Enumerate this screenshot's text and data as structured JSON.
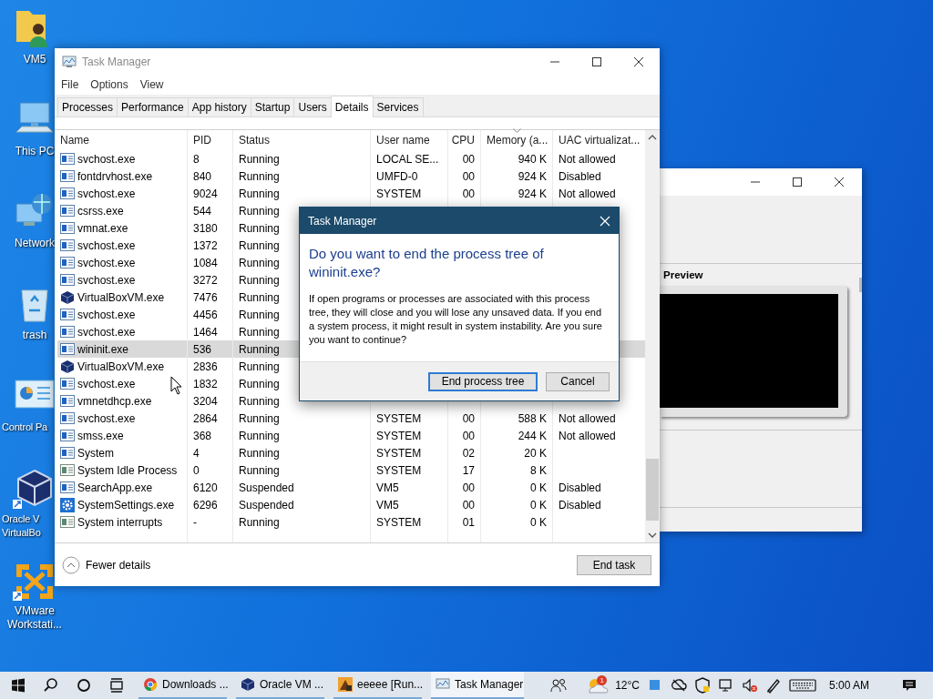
{
  "desktop_icons": [
    {
      "kind": "user-folder",
      "lines": [
        "VM5"
      ]
    },
    {
      "kind": "pc",
      "lines": [
        "This PC"
      ]
    },
    {
      "kind": "network",
      "lines": [
        "Network"
      ]
    },
    {
      "kind": "recycle-bin",
      "lines": [
        "trash"
      ]
    },
    {
      "kind": "control-panel",
      "lines": [
        "Control Pa"
      ]
    },
    {
      "kind": "virtualbox",
      "lines": [
        "Oracle V",
        "VirtualBo"
      ]
    },
    {
      "kind": "vmware",
      "lines": [
        "VMware",
        "Workstati..."
      ]
    }
  ],
  "task_manager": {
    "title": "Task Manager",
    "menu": [
      "File",
      "Options",
      "View"
    ],
    "tabs": [
      {
        "label": "Processes",
        "selected": false
      },
      {
        "label": "Performance",
        "selected": false
      },
      {
        "label": "App history",
        "selected": false
      },
      {
        "label": "Startup",
        "selected": false
      },
      {
        "label": "Users",
        "selected": false
      },
      {
        "label": "Details",
        "selected": true
      },
      {
        "label": "Services",
        "selected": false
      }
    ],
    "columns": [
      {
        "label": "Name",
        "sorted": false
      },
      {
        "label": "PID",
        "sorted": false
      },
      {
        "label": "Status",
        "sorted": false
      },
      {
        "label": "User name",
        "sorted": false
      },
      {
        "label": "CPU",
        "sorted": false
      },
      {
        "label": "Memory (a...",
        "sorted": true
      },
      {
        "label": "UAC virtualizat...",
        "sorted": false
      }
    ],
    "rows": [
      {
        "kind": "app",
        "name": "svchost.exe",
        "pid": "8",
        "status": "Running",
        "user_name": "LOCAL SE...",
        "cpu": "00",
        "memory": "940 K",
        "uac": "Not allowed",
        "selected": false
      },
      {
        "kind": "app",
        "name": "fontdrvhost.exe",
        "pid": "840",
        "status": "Running",
        "user_name": "UMFD-0",
        "cpu": "00",
        "memory": "924 K",
        "uac": "Disabled",
        "selected": false
      },
      {
        "kind": "app",
        "name": "svchost.exe",
        "pid": "9024",
        "status": "Running",
        "user_name": "SYSTEM",
        "cpu": "00",
        "memory": "924 K",
        "uac": "Not allowed",
        "selected": false
      },
      {
        "kind": "app",
        "name": "csrss.exe",
        "pid": "544",
        "status": "Running",
        "selected": false
      },
      {
        "kind": "app",
        "name": "vmnat.exe",
        "pid": "3180",
        "status": "Running",
        "selected": false
      },
      {
        "kind": "app",
        "name": "svchost.exe",
        "pid": "1372",
        "status": "Running",
        "selected": false
      },
      {
        "kind": "app",
        "name": "svchost.exe",
        "pid": "1084",
        "status": "Running",
        "selected": false
      },
      {
        "kind": "app",
        "name": "svchost.exe",
        "pid": "3272",
        "status": "Running",
        "selected": false
      },
      {
        "kind": "virtualbox",
        "name": "VirtualBoxVM.exe",
        "pid": "7476",
        "status": "Running",
        "selected": false
      },
      {
        "kind": "app",
        "name": "svchost.exe",
        "pid": "4456",
        "status": "Running",
        "selected": false
      },
      {
        "kind": "app",
        "name": "svchost.exe",
        "pid": "1464",
        "status": "Running",
        "selected": false
      },
      {
        "kind": "app",
        "name": "wininit.exe",
        "pid": "536",
        "status": "Running",
        "selected": true
      },
      {
        "kind": "virtualbox",
        "name": "VirtualBoxVM.exe",
        "pid": "2836",
        "status": "Running",
        "selected": false
      },
      {
        "kind": "app",
        "name": "svchost.exe",
        "pid": "1832",
        "status": "Running",
        "selected": false
      },
      {
        "kind": "app",
        "name": "vmnetdhcp.exe",
        "pid": "3204",
        "status": "Running",
        "selected": false
      },
      {
        "kind": "app",
        "name": "svchost.exe",
        "pid": "2864",
        "status": "Running",
        "user_name": "SYSTEM",
        "cpu": "00",
        "memory": "588 K",
        "uac": "Not allowed",
        "selected": false
      },
      {
        "kind": "app",
        "name": "smss.exe",
        "pid": "368",
        "status": "Running",
        "user_name": "SYSTEM",
        "cpu": "00",
        "memory": "244 K",
        "uac": "Not allowed",
        "selected": false
      },
      {
        "kind": "app",
        "name": "System",
        "pid": "4",
        "status": "Running",
        "user_name": "SYSTEM",
        "cpu": "02",
        "memory": "20 K",
        "selected": false
      },
      {
        "kind": "generic",
        "name": "System Idle Process",
        "pid": "0",
        "status": "Running",
        "user_name": "SYSTEM",
        "cpu": "17",
        "memory": "8 K",
        "selected": false
      },
      {
        "kind": "app",
        "name": "SearchApp.exe",
        "pid": "6120",
        "status": "Suspended",
        "user_name": "VM5",
        "cpu": "00",
        "memory": "0 K",
        "uac": "Disabled",
        "selected": false
      },
      {
        "kind": "settings",
        "name": "SystemSettings.exe",
        "pid": "6296",
        "status": "Suspended",
        "user_name": "VM5",
        "cpu": "00",
        "memory": "0 K",
        "uac": "Disabled",
        "selected": false
      },
      {
        "kind": "generic",
        "name": "System interrupts",
        "pid": "-",
        "status": "Running",
        "user_name": "SYSTEM",
        "cpu": "01",
        "memory": "0 K",
        "selected": false
      }
    ],
    "fewer_details": "Fewer details",
    "end_task": "End task"
  },
  "dialog": {
    "title": "Task Manager",
    "heading": "Do you want to end the process tree of wininit.exe?",
    "message": "If open programs or processes are associated with this process tree, they will close and you will lose any unsaved data. If you end a system process, it might result in system instability. Are you sure you want to continue?",
    "buttons": [
      {
        "label": "End process tree",
        "default": true
      },
      {
        "label": "Cancel",
        "default": false
      }
    ]
  },
  "background_window": {
    "section_label": "Preview"
  },
  "taskbar": {
    "apps": [
      {
        "kind": "chrome",
        "label": "Downloads ...",
        "active": false
      },
      {
        "kind": "virtualbox",
        "label": "Oracle VM ...",
        "active": false
      },
      {
        "kind": "vm",
        "label": "eeeee [Run...",
        "active": false
      },
      {
        "kind": "taskmgr",
        "label": "Task Manager",
        "active": true
      }
    ],
    "weather": {
      "badge": "1",
      "temperature": "12°C"
    },
    "clock": "5:00 AM"
  }
}
